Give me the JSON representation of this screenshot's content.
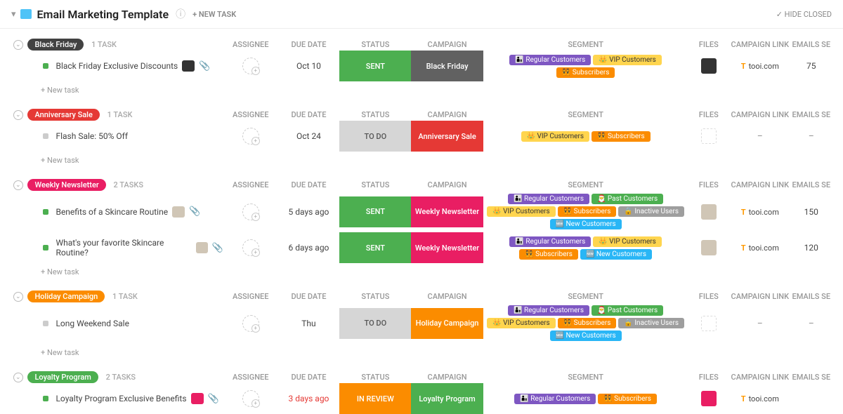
{
  "header": {
    "title": "Email Marketing Template",
    "new_task": "+ NEW TASK",
    "hide_closed": "HIDE CLOSED"
  },
  "cols": {
    "assignee": "ASSIGNEE",
    "due": "DUE DATE",
    "status": "STATUS",
    "campaign": "CAMPAIGN",
    "segment": "SEGMENT",
    "files": "FILES",
    "link": "CAMPAIGN LINK",
    "emails": "EMAILS SE"
  },
  "labels": {
    "newtask": "+ New task"
  },
  "tags": {
    "regular": {
      "emoji": "👨‍👦",
      "label": "Regular Customers",
      "c": "#7e57c2"
    },
    "vip": {
      "emoji": "👑",
      "label": "VIP Customers",
      "c": "#ffd54f",
      "fg": "#333"
    },
    "subs": {
      "emoji": "👯",
      "label": "Subscribers",
      "c": "#fb8c00"
    },
    "past": {
      "emoji": "🎅",
      "label": "Past Customers",
      "c": "#4caf50"
    },
    "inactive": {
      "emoji": "🔒",
      "label": "Inactive Users",
      "c": "#9e9e9e"
    },
    "new": {
      "emoji": "🆕",
      "label": "New Customers",
      "c": "#29b6f6"
    }
  },
  "sections": [
    {
      "name": "Black Friday",
      "badge_c": "#424242",
      "count": "1 TASK",
      "tasks": [
        {
          "sq": "#4caf50",
          "title": "Black Friday Exclusive Discounts",
          "thumb": "#333",
          "clip": true,
          "date": "Oct 10",
          "status": "SENT",
          "status_c": "#4caf50",
          "camp": "Black Friday",
          "camp_c": "#616161",
          "seg": [
            "regular",
            "vip",
            "subs"
          ],
          "file": "#333",
          "link": "tooi.com",
          "emails": "75"
        }
      ]
    },
    {
      "name": "Anniversary Sale",
      "badge_c": "#e53935",
      "count": "1 TASK",
      "tasks": [
        {
          "sq": "#ccc",
          "title": "Flash Sale: 50% Off",
          "thumb": null,
          "clip": false,
          "date": "Oct 24",
          "status": "TO DO",
          "status_c": "#d6d6d6",
          "status_fg": "#555",
          "camp": "Anniversary Sale",
          "camp_c": "#e53935",
          "seg": [
            "vip",
            "subs"
          ],
          "file": null,
          "link": "–",
          "emails": "–"
        }
      ]
    },
    {
      "name": "Weekly Newsletter",
      "badge_c": "#e91e63",
      "count": "2 TASKS",
      "tasks": [
        {
          "sq": "#4caf50",
          "title": "Benefits of a Skincare Routine",
          "thumb": "#d0c6b6",
          "clip": true,
          "date": "5 days ago",
          "status": "SENT",
          "status_c": "#4caf50",
          "camp": "Weekly Newsletter",
          "camp_c": "#e91e63",
          "seg": [
            "regular",
            "past",
            "vip",
            "subs",
            "inactive",
            "new"
          ],
          "file": "#d0c6b6",
          "link": "tooi.com",
          "emails": "150"
        },
        {
          "sq": "#4caf50",
          "title": "What's your favorite Skincare Routine?",
          "thumb": "#d0c6b6",
          "clip": true,
          "date": "6 days ago",
          "status": "SENT",
          "status_c": "#4caf50",
          "camp": "Weekly Newsletter",
          "camp_c": "#e91e63",
          "seg": [
            "regular",
            "vip",
            "subs",
            "new"
          ],
          "file": "#d0c6b6",
          "link": "tooi.com",
          "emails": "120"
        }
      ]
    },
    {
      "name": "Holiday Campaign",
      "badge_c": "#fb8c00",
      "count": "1 TASK",
      "tasks": [
        {
          "sq": "#ccc",
          "title": "Long Weekend Sale",
          "thumb": null,
          "clip": false,
          "date": "Thu",
          "status": "TO DO",
          "status_c": "#d6d6d6",
          "status_fg": "#555",
          "camp": "Holiday Campaign",
          "camp_c": "#fb8c00",
          "seg": [
            "regular",
            "past",
            "vip",
            "subs",
            "inactive",
            "new"
          ],
          "file": null,
          "link": "–",
          "emails": "–"
        }
      ]
    },
    {
      "name": "Loyalty Program",
      "badge_c": "#4caf50",
      "count": "2 TASKS",
      "no_add": true,
      "tasks": [
        {
          "sq": "#4caf50",
          "title": "Loyalty Program Exclusive Benefits",
          "thumb": "#e91e63",
          "clip": true,
          "date": "3 days ago",
          "date_overdue": true,
          "status": "IN REVIEW",
          "status_c": "#fb8c00",
          "camp": "Loyalty Program",
          "camp_c": "#4caf50",
          "seg": [
            "regular",
            "subs"
          ],
          "file": "#e91e63",
          "link": "tooi.com",
          "emails": ""
        }
      ]
    }
  ]
}
